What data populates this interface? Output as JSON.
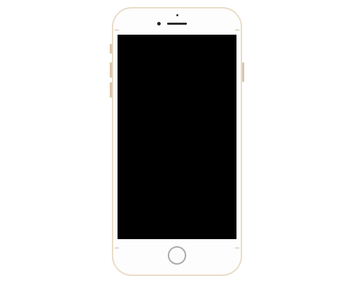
{
  "device": {
    "type": "smartphone",
    "frame_color": "#e9dcc8",
    "face_color": "#fdfdfd",
    "screen_color": "#000000",
    "screen_state": "off",
    "icons": {
      "camera": "front-camera-icon",
      "speaker": "earpiece-speaker-icon",
      "home": "home-button"
    }
  }
}
